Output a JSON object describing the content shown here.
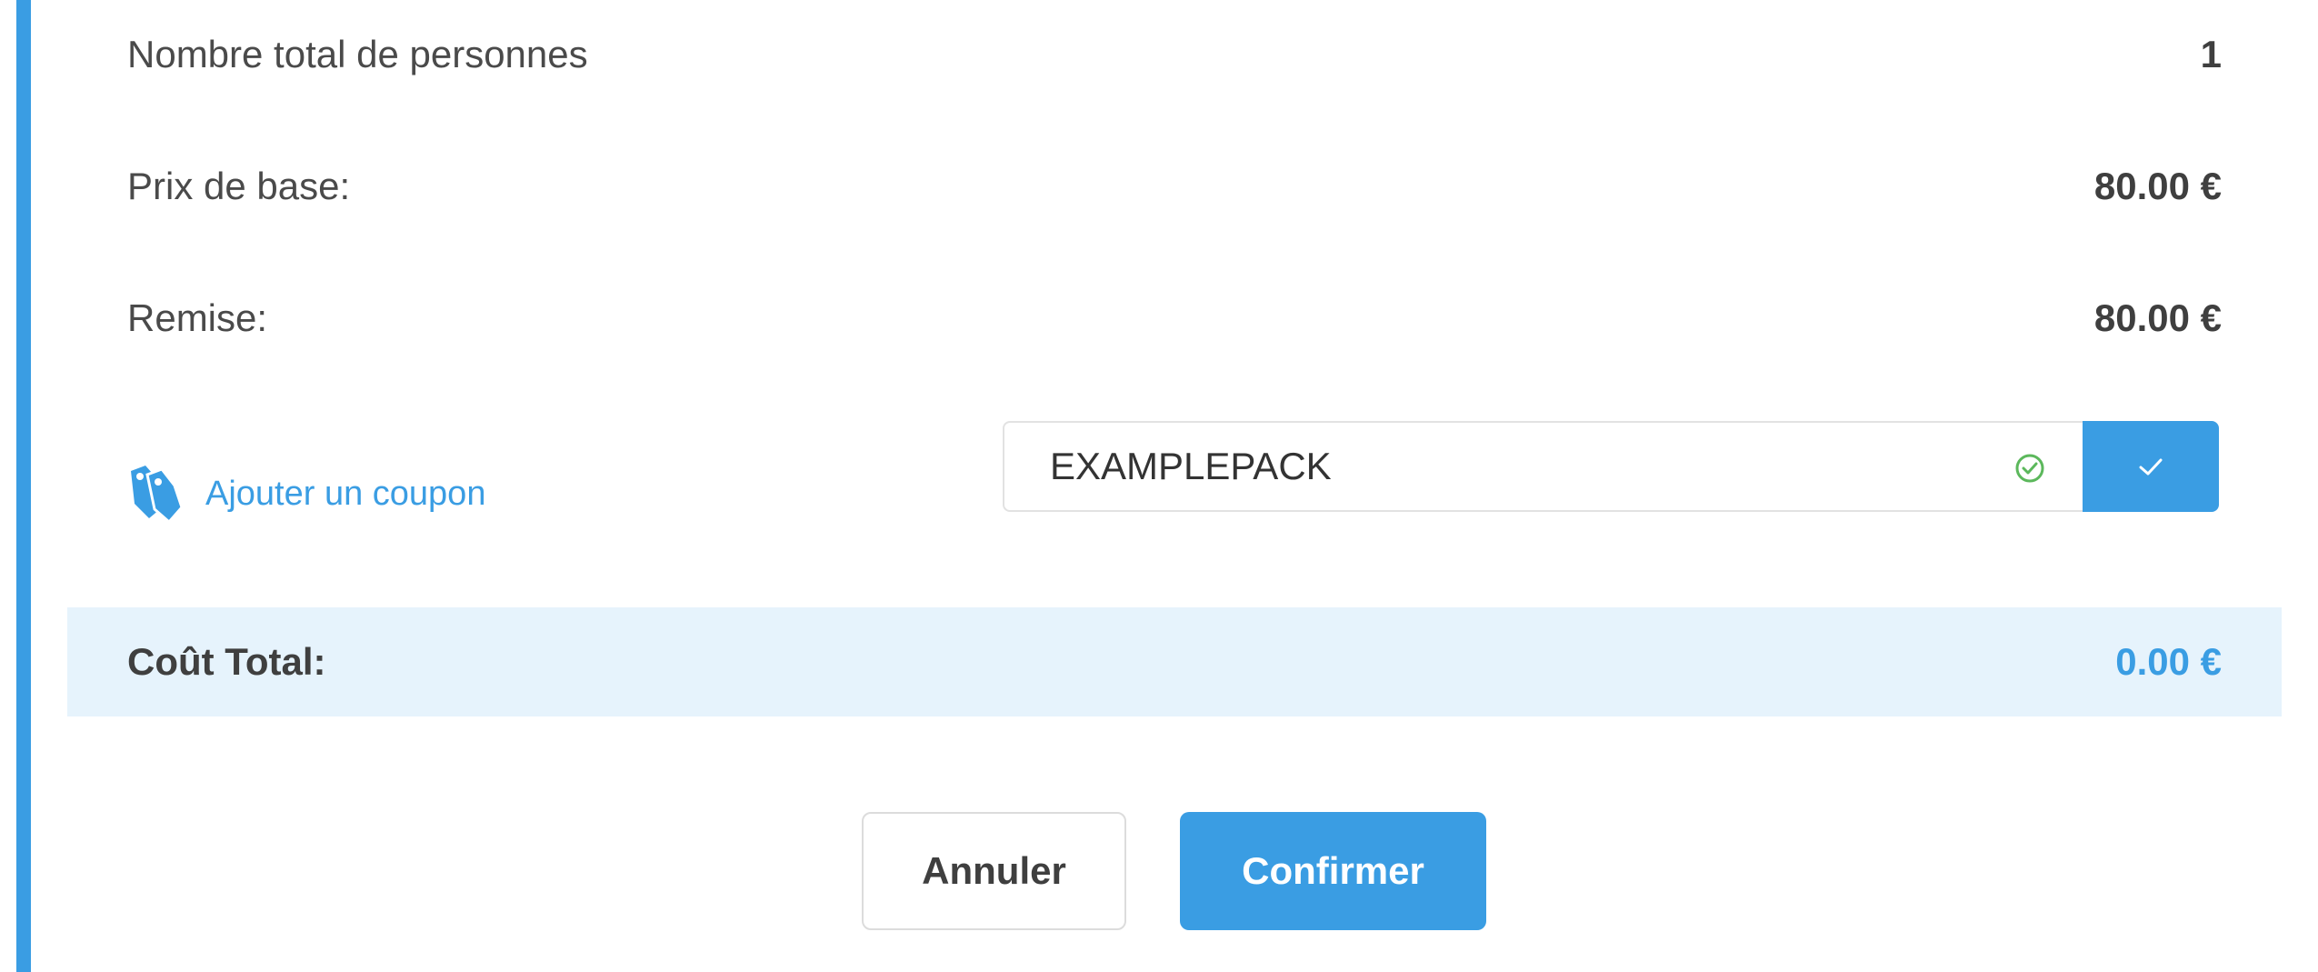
{
  "summary": {
    "persons_label": "Nombre total de personnes",
    "persons_value": "1",
    "base_price_label": "Prix de base:",
    "base_price_value": "80.00 €",
    "discount_label": "Remise:",
    "discount_value": "80.00 €"
  },
  "coupon": {
    "link_label": "Ajouter un coupon",
    "link_icon": "coupon-tags-icon",
    "code_value": "EXAMPLEPACK",
    "valid_icon": "check-circle-icon",
    "apply_icon": "checkmark-icon"
  },
  "total": {
    "label": "Coût Total:",
    "value": "0.00 €"
  },
  "actions": {
    "cancel_label": "Annuler",
    "confirm_label": "Confirmer"
  },
  "colors": {
    "accent": "#3a9de3",
    "total_band": "#e6f3fc",
    "valid_green": "#5cb85c"
  }
}
